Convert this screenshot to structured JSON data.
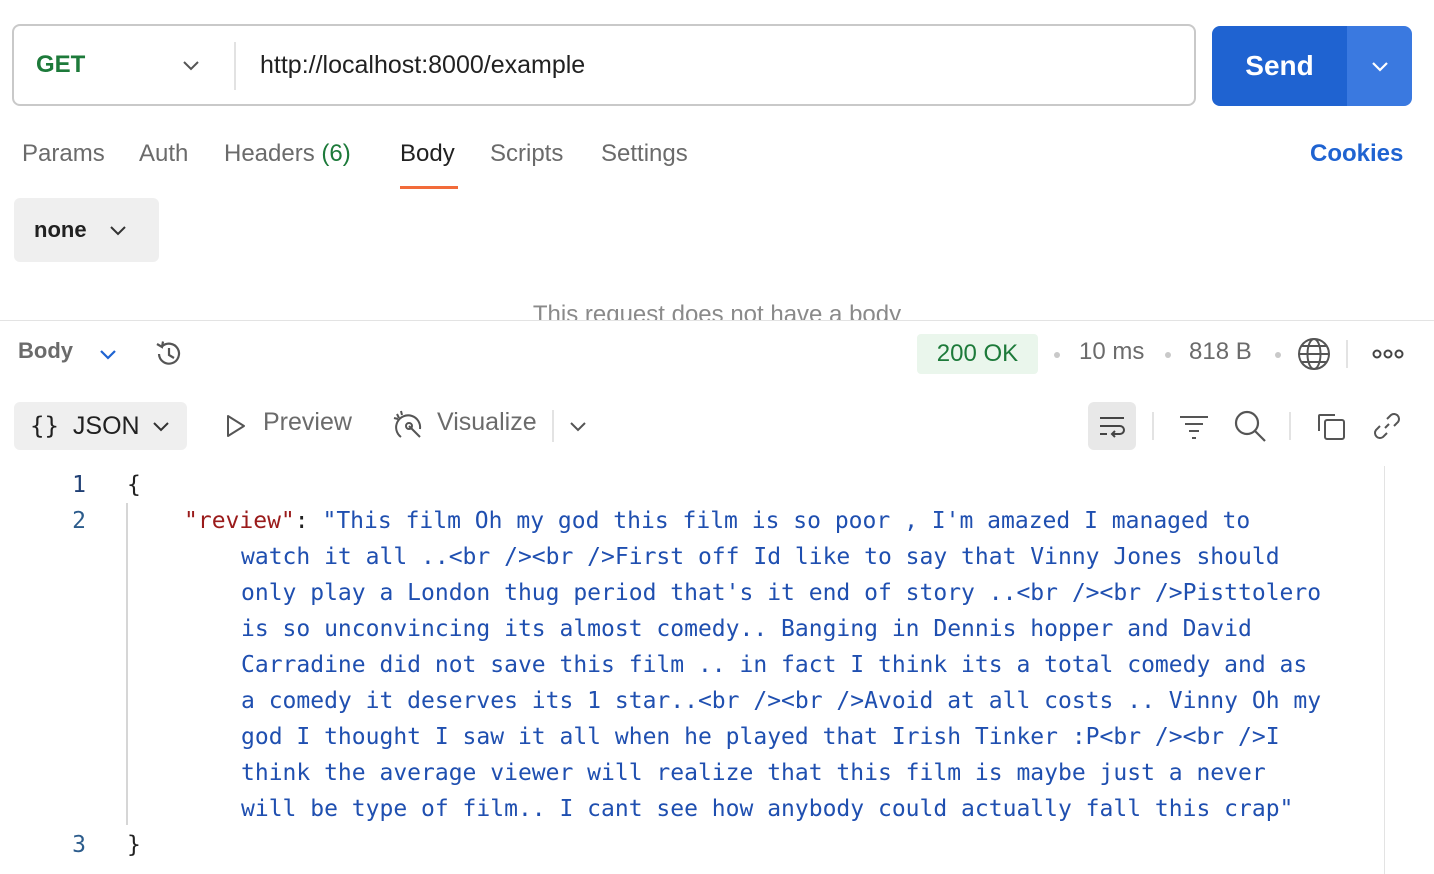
{
  "request": {
    "method": "GET",
    "url": "http://localhost:8000/example",
    "send_label": "Send"
  },
  "tabs": [
    {
      "label": "Params"
    },
    {
      "label": "Auth"
    },
    {
      "label": "Headers",
      "count": "(6)"
    },
    {
      "label": "Body",
      "active": true
    },
    {
      "label": "Scripts"
    },
    {
      "label": "Settings"
    }
  ],
  "cookies_label": "Cookies",
  "body_type": "none",
  "empty_body_message": "This request does not have a body",
  "response": {
    "section_label": "Body",
    "status": "200 OK",
    "time": "10 ms",
    "size": "818 B",
    "format_label": "JSON",
    "preview_label": "Preview",
    "visualize_label": "Visualize"
  },
  "code": {
    "line_numbers": [
      "1",
      "2",
      "3"
    ],
    "open_brace": "{",
    "close_brace": "}",
    "key": "\"review\"",
    "colon": ": ",
    "value_lines": [
      "\"This film Oh my god this film is so poor , I'm amazed I managed to",
      "watch it all ..<br /><br />First off Id like to say that Vinny Jones should",
      "only play a London thug period that's it end of story ..<br /><br />Pisttolero",
      "is so unconvincing its almost comedy.. Banging in Dennis hopper and David",
      "Carradine did not save this film .. in fact I think its a total comedy and as",
      "a comedy it deserves its 1 star..<br /><br />Avoid at all costs .. Vinny Oh my",
      "god I thought I saw it all when he played that Irish Tinker :P<br /><br />I",
      "think the average viewer will realize that this film is maybe just a never",
      "will be type of film.. I cant see how anybody could actually fall this crap\""
    ]
  },
  "colors": {
    "accent": "#1f63d1",
    "method": "#1d7a3a",
    "tab_underline": "#f26b3a",
    "json_key": "#9a1b1b",
    "json_string": "#1f4fb0"
  },
  "icons": [
    "chevron-down-icon",
    "history-icon",
    "globe-icon",
    "more-icon",
    "braces-icon",
    "play-icon",
    "visualize-icon",
    "wrap-icon",
    "filter-icon",
    "search-icon",
    "copy-icon",
    "link-icon"
  ]
}
